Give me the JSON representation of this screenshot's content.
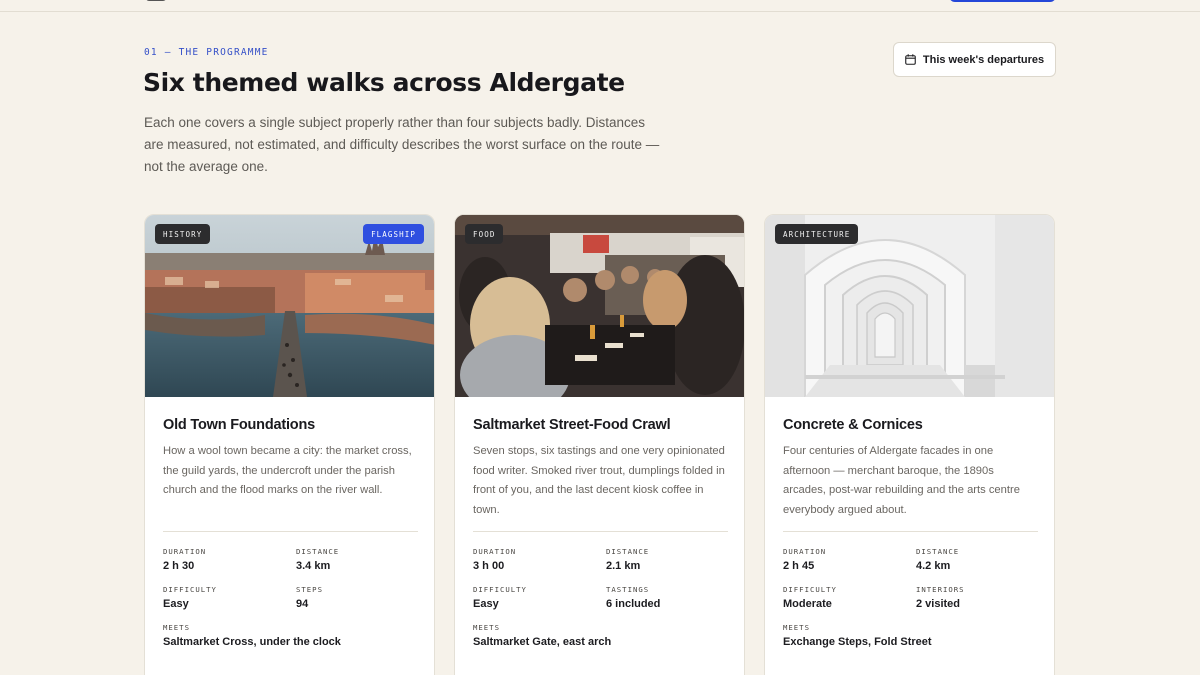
{
  "section": {
    "eyebrow": "01 — THE PROGRAMME",
    "title": "Six themed walks across Aldergate",
    "lede": "Each one covers a single subject properly rather than four subjects badly. Distances are measured, not estimated, and difficulty describes the worst surface on the route — not the average one.",
    "departures_label": "This week's departures"
  },
  "icons": {
    "departures": "calendar-icon"
  },
  "colors": {
    "accent": "#3550c8",
    "flagship": "#2f4fe0",
    "background": "#f6f2ea"
  },
  "cards": [
    {
      "tag": "HISTORY",
      "flag": "FLAGSHIP",
      "title": "Old Town Foundations",
      "description": "How a wool town became a city: the market cross, the guild yards, the undercroft under the parish church and the flood marks on the river wall.",
      "stats": [
        {
          "label": "DURATION",
          "value": "2 h 30"
        },
        {
          "label": "DISTANCE",
          "value": "3.4 km"
        },
        {
          "label": "DIFFICULTY",
          "value": "Easy"
        },
        {
          "label": "STEPS",
          "value": "94"
        },
        {
          "label": "MEETS",
          "value": "Saltmarket Cross, under the clock"
        }
      ]
    },
    {
      "tag": "FOOD",
      "title": "Saltmarket Street-Food Crawl",
      "description": "Seven stops, six tastings and one very opinionated food writer. Smoked river trout, dumplings folded in front of you, and the last decent kiosk coffee in town.",
      "stats": [
        {
          "label": "DURATION",
          "value": "3 h 00"
        },
        {
          "label": "DISTANCE",
          "value": "2.1 km"
        },
        {
          "label": "DIFFICULTY",
          "value": "Easy"
        },
        {
          "label": "TASTINGS",
          "value": "6 included"
        },
        {
          "label": "MEETS",
          "value": "Saltmarket Gate, east arch"
        }
      ]
    },
    {
      "tag": "ARCHITECTURE",
      "title": "Concrete & Cornices",
      "description": "Four centuries of Aldergate facades in one afternoon — merchant baroque, the 1890s arcades, post-war rebuilding and the arts centre everybody argued about.",
      "stats": [
        {
          "label": "DURATION",
          "value": "2 h 45"
        },
        {
          "label": "DISTANCE",
          "value": "4.2 km"
        },
        {
          "label": "DIFFICULTY",
          "value": "Moderate"
        },
        {
          "label": "INTERIORS",
          "value": "2 visited"
        },
        {
          "label": "MEETS",
          "value": "Exchange Steps, Fold Street"
        }
      ]
    }
  ]
}
